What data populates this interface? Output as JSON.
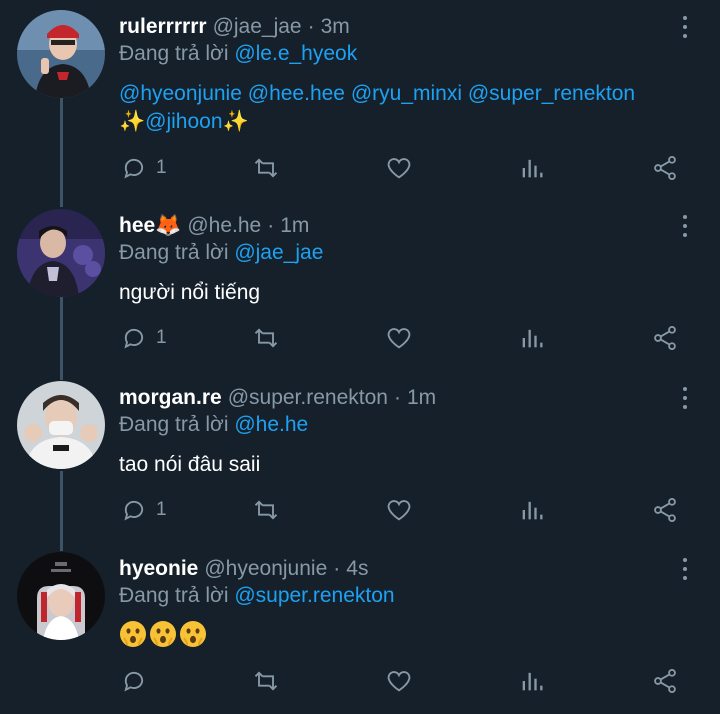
{
  "tweets": [
    {
      "name": "rulerrrrrr",
      "handle": "@jae_jae",
      "dot": "·",
      "time": "3m",
      "reply_prefix": "Đang trả lời",
      "reply_to": "@le.e_hyeok",
      "body_mentions": [
        "@hyeonjunie",
        "@hee.hee",
        "@ryu_minxi",
        "@super_renekton"
      ],
      "body_line2_prefix": "✨",
      "body_line2_mention": "@jihoon",
      "body_line2_suffix": "✨",
      "reply_count": "1"
    },
    {
      "name": "hee🦊",
      "handle": "@he.he",
      "dot": "·",
      "time": "1m",
      "reply_prefix": "Đang trả lời",
      "reply_to": "@jae_jae",
      "body": "người nổi tiếng",
      "reply_count": "1"
    },
    {
      "name": "morgan.re",
      "handle": "@super.renekton",
      "dot": "·",
      "time": "1m",
      "reply_prefix": "Đang trả lời",
      "reply_to": "@he.he",
      "body": "tao nói đâu saii",
      "reply_count": "1"
    },
    {
      "name": "hyeonie",
      "handle": "@hyeonjunie",
      "dot": "·",
      "time": "4s",
      "reply_prefix": "Đang trả lời",
      "reply_to": "@super.renekton",
      "body_emoji": "😯😯😯",
      "reply_count": ""
    }
  ],
  "colors": {
    "background": "#15202b",
    "muted": "#8899a6",
    "link": "#1da1f2",
    "thread_line": "#3d5466"
  },
  "icons": [
    "reply-icon",
    "retweet-icon",
    "like-icon",
    "analytics-icon",
    "share-icon",
    "more-icon"
  ]
}
